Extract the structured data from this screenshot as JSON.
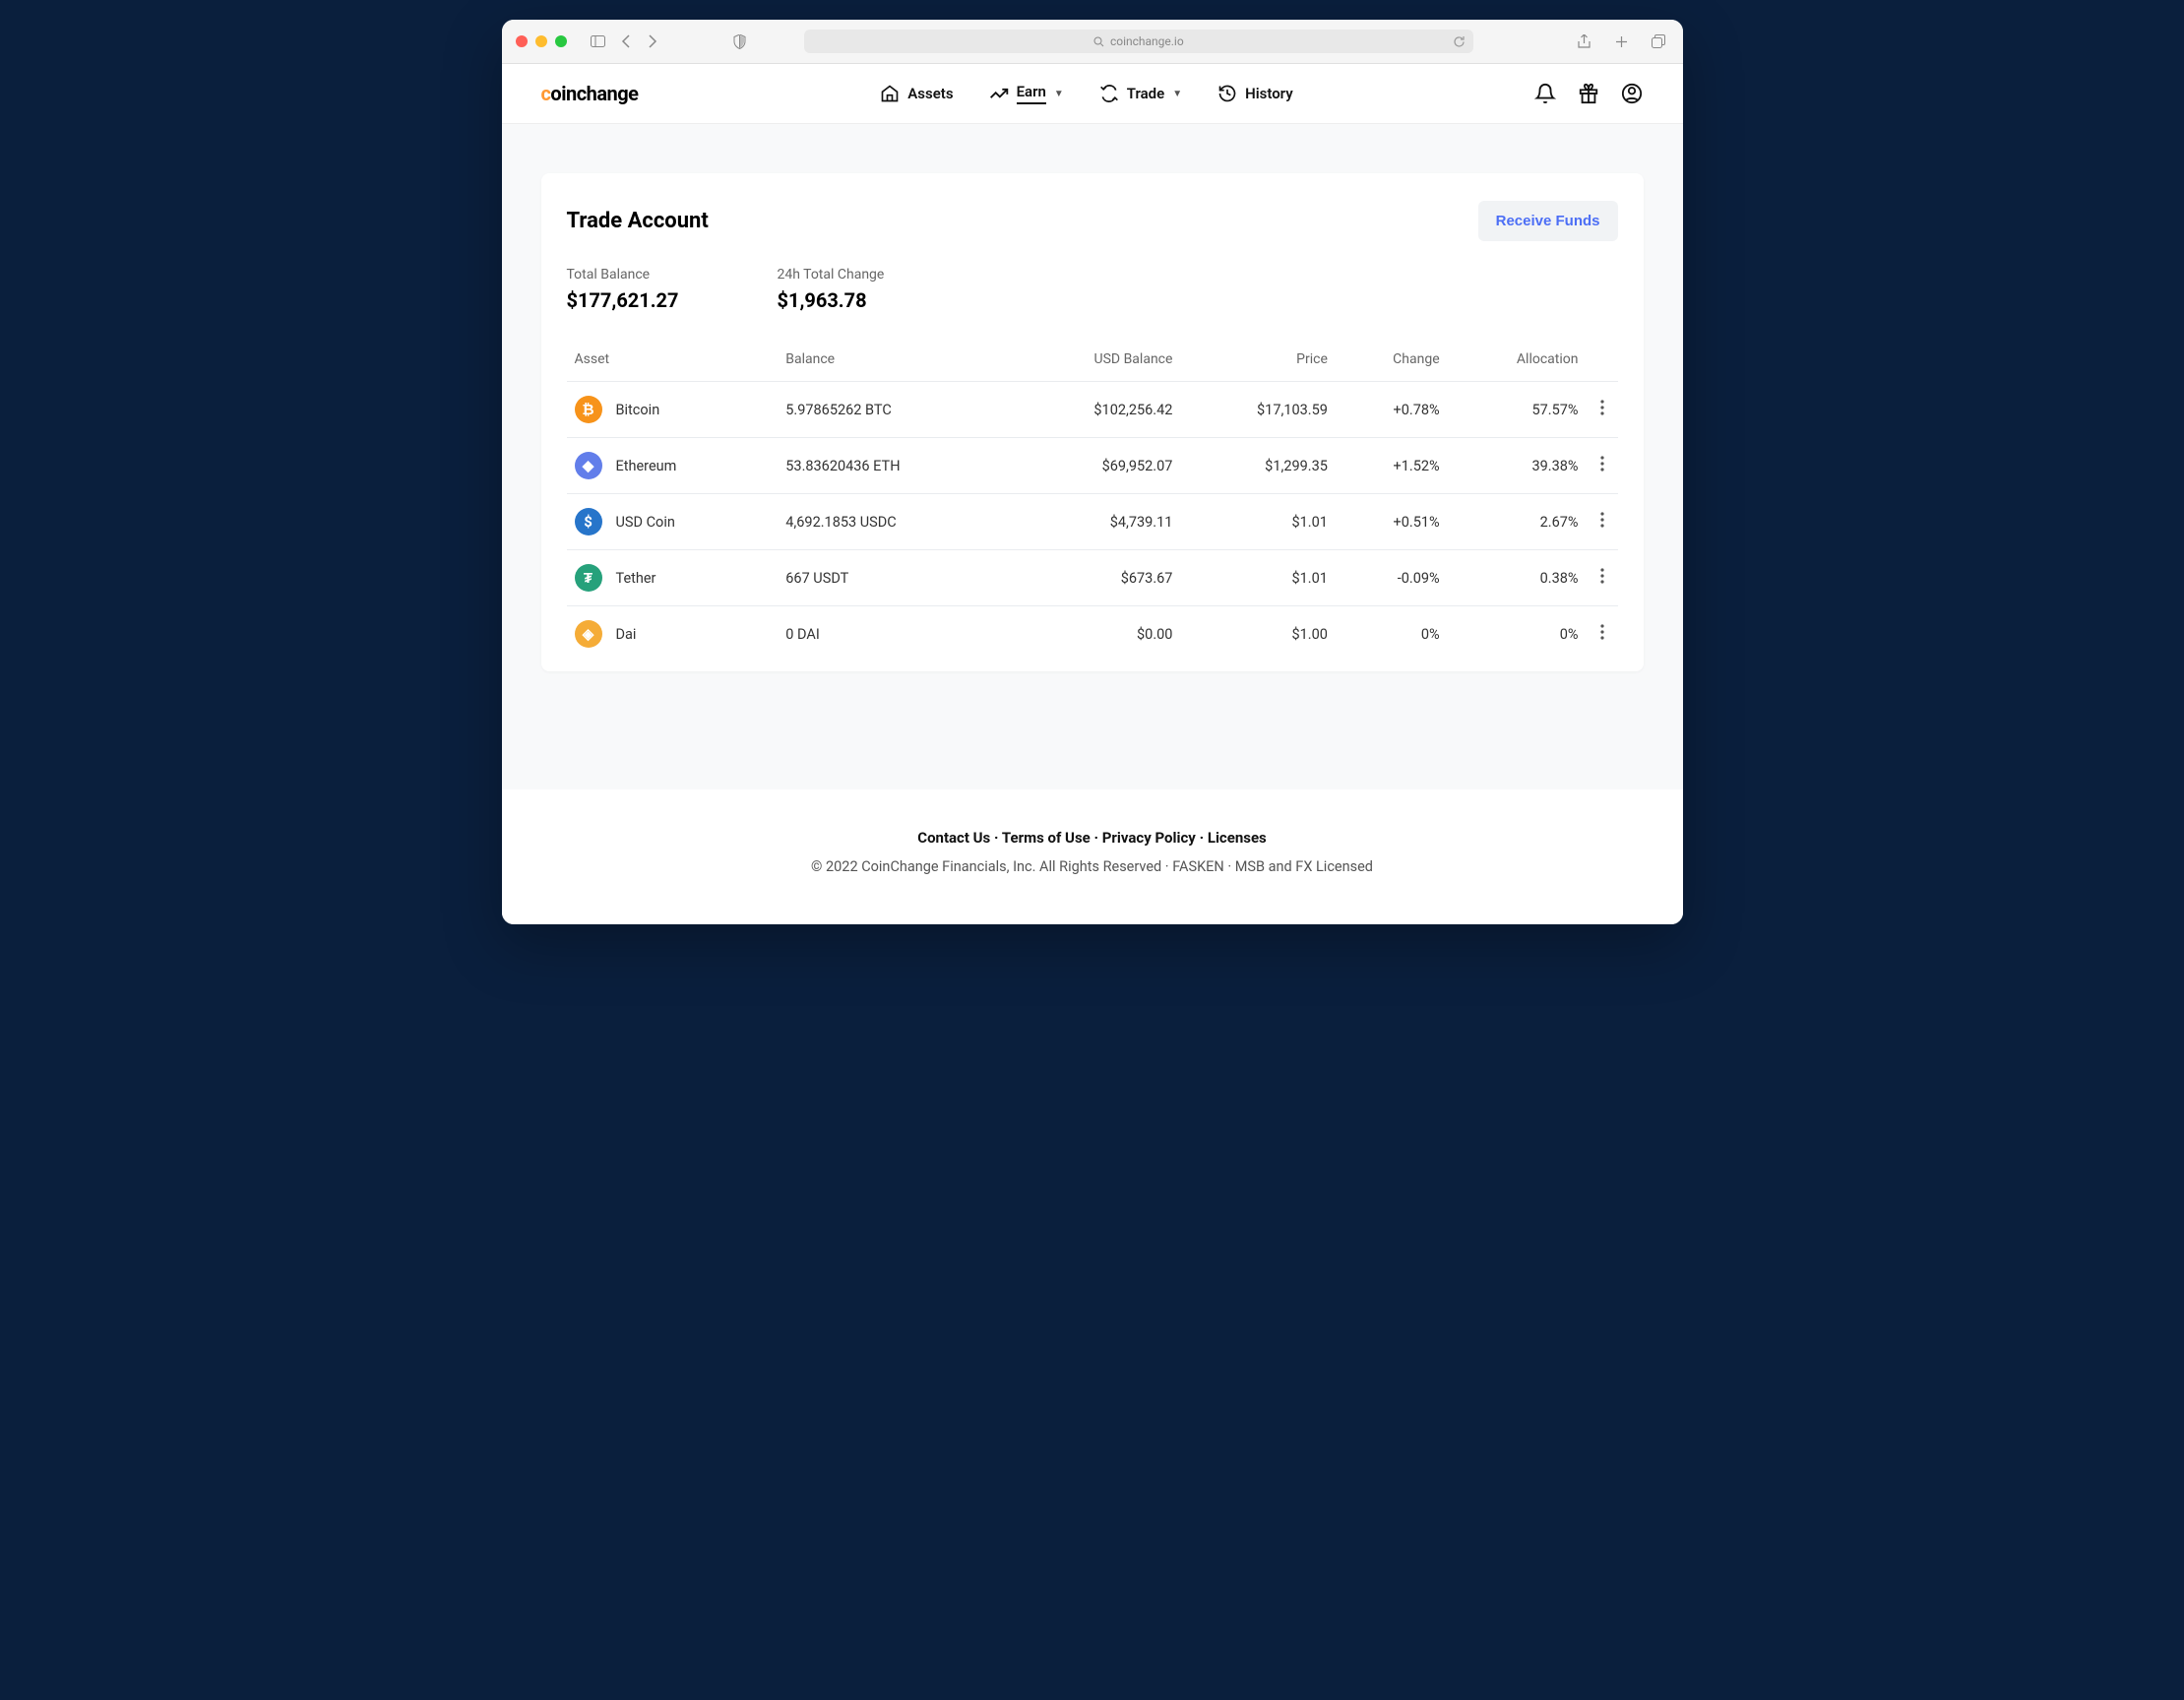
{
  "browser": {
    "url": "coinchange.io"
  },
  "brand": {
    "pre": "c",
    "rest": "oinchange"
  },
  "nav": {
    "items": [
      {
        "label": "Assets",
        "icon": "home"
      },
      {
        "label": "Earn",
        "icon": "trend",
        "caret": true,
        "active": true
      },
      {
        "label": "Trade",
        "icon": "cycle",
        "caret": true
      },
      {
        "label": "History",
        "icon": "history"
      }
    ]
  },
  "page": {
    "title": "Trade Account",
    "receiveBtn": "Receive Funds",
    "stats": [
      {
        "label": "Total Balance",
        "value": "$177,621.27"
      },
      {
        "label": "24h Total Change",
        "value": "$1,963.78"
      }
    ],
    "columns": [
      "Asset",
      "Balance",
      "USD Balance",
      "Price",
      "Change",
      "Allocation"
    ],
    "rows": [
      {
        "name": "Bitcoin",
        "iconBg": "#f7931a",
        "iconTxt": "₿",
        "balance": "5.97865262 BTC",
        "usd": "$102,256.42",
        "price": "$17,103.59",
        "change": "+0.78%",
        "dir": "pos",
        "alloc": "57.57%"
      },
      {
        "name": "Ethereum",
        "iconBg": "#627eea",
        "iconTxt": "◆",
        "balance": "53.83620436 ETH",
        "usd": "$69,952.07",
        "price": "$1,299.35",
        "change": "+1.52%",
        "dir": "pos",
        "alloc": "39.38%"
      },
      {
        "name": "USD Coin",
        "iconBg": "#2775ca",
        "iconTxt": "$",
        "balance": "4,692.1853 USDC",
        "usd": "$4,739.11",
        "price": "$1.01",
        "change": "+0.51%",
        "dir": "pos",
        "alloc": "2.67%"
      },
      {
        "name": "Tether",
        "iconBg": "#26a17b",
        "iconTxt": "₮",
        "balance": "667 USDT",
        "usd": "$673.67",
        "price": "$1.01",
        "change": "-0.09%",
        "dir": "neg",
        "alloc": "0.38%"
      },
      {
        "name": "Dai",
        "iconBg": "#f5ac37",
        "iconTxt": "◈",
        "balance": "0 DAI",
        "usd": "$0.00",
        "price": "$1.00",
        "change": "0%",
        "dir": "",
        "alloc": "0%"
      }
    ]
  },
  "footer": {
    "links": [
      "Contact Us",
      "Terms of Use",
      "Privacy Policy",
      "Licenses"
    ],
    "sep": " · ",
    "copy": "© 2022 CoinChange Financials, Inc. All Rights Reserved · FASKEN · MSB and FX Licensed"
  }
}
